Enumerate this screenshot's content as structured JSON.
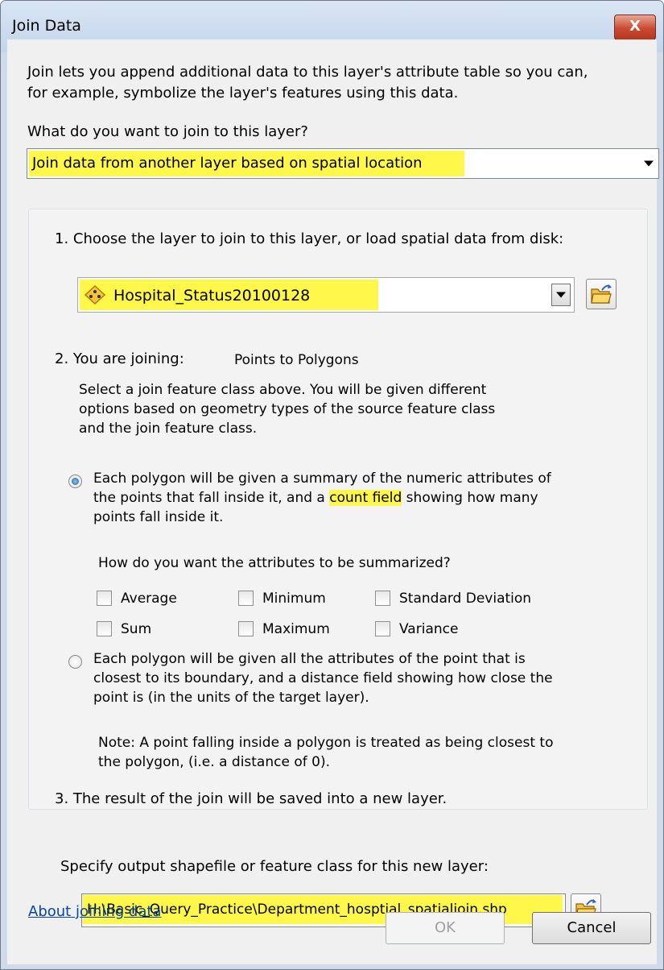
{
  "window": {
    "title": "Join Data",
    "close_label": "X"
  },
  "intro": {
    "line1": "Join lets you append additional data to this layer's attribute table so you can,",
    "line2": "for example, symbolize the layer's features using this data."
  },
  "join_question": "What do you want to join to this layer?",
  "join_type": {
    "selected": "Join data from another layer based on spatial location"
  },
  "step1": {
    "label": "1.  Choose the layer to join to this layer, or load spatial data from disk:",
    "layer_selected": "Hospital_Status20100128"
  },
  "step2": {
    "label": "2.  You are joining:",
    "joining_value": "Points to Polygons",
    "help_line1": "Select a join feature class above.  You will be given different",
    "help_line2": "options based on geometry types of the source feature class",
    "help_line3": "and the join feature class.",
    "option1_line1": "Each polygon will be given a summary of the numeric attributes of",
    "option1_line2_prefix": "the points that fall inside it, and a ",
    "option1_line2_highlight": "count field",
    "option1_line2_suffix": " showing how many",
    "option1_line3": "points fall inside it.",
    "summary_question": "How do you want the attributes to be summarized?",
    "checkboxes": {
      "average": "Average",
      "minimum": "Minimum",
      "standard_deviation": "Standard Deviation",
      "sum": "Sum",
      "maximum": "Maximum",
      "variance": "Variance"
    },
    "option2_line1": "Each polygon will be given all the attributes of the point that is",
    "option2_line2": "closest to its boundary, and a distance field showing how close the",
    "option2_line3": "point is (in the units of the target layer).",
    "note_line1": "Note: A point falling inside a polygon is treated as being closest to",
    "note_line2": "the polygon, (i.e. a distance of 0)."
  },
  "step3": {
    "label": "3.  The result of the join will be saved into a new layer.",
    "specify": "Specify output shapefile or feature class for this new layer:",
    "output_path": "H:\\Basic_Query_Practice\\Department_hosptial_spatialjoin.shp"
  },
  "footer": {
    "about_link": "About joining data",
    "ok_label": "OK",
    "cancel_label": "Cancel"
  }
}
